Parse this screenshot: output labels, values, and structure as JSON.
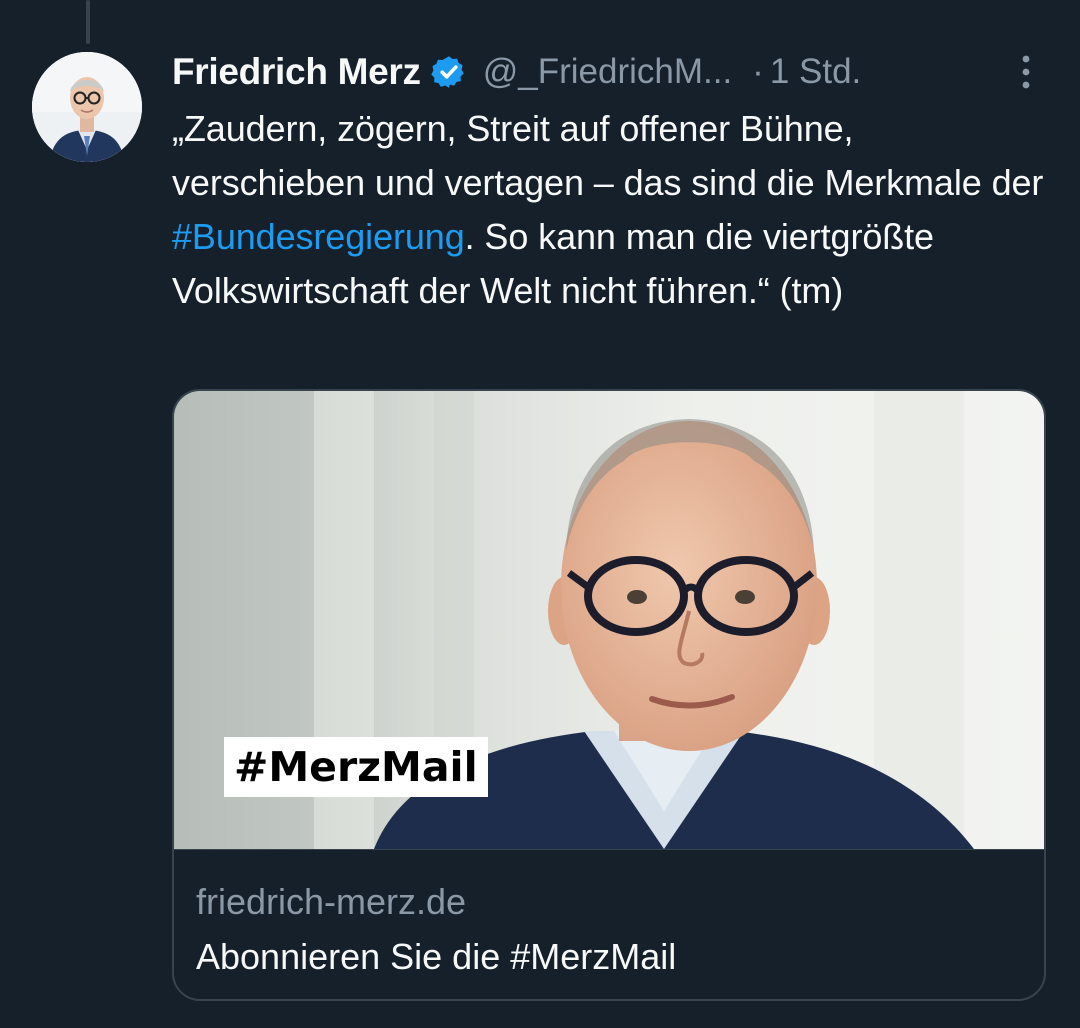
{
  "tweet": {
    "author": {
      "name": "Friedrich Merz",
      "handle": "@_FriedrichM...",
      "verified": true
    },
    "separator": "·",
    "time": "1 Std.",
    "text_parts": {
      "p1": "„Zaudern, zögern, Streit auf offener Bühne, verschieben und vertagen – das sind die Merkmale der ",
      "hashtag": "#Bundesregierung",
      "p2": ". So kann man die viertgrößte Volkswirtschaft der Welt nicht führen.“ (tm)"
    }
  },
  "card": {
    "image_label": "#MerzMail",
    "domain": "friedrich-merz.de",
    "title": "Abonnieren Sie die #MerzMail"
  },
  "colors": {
    "background": "#15202b",
    "text": "#f7f9f9",
    "muted": "#8b98a5",
    "accent": "#1d9bf0",
    "border": "#38444d"
  },
  "icons": {
    "verified": "verified-badge-icon",
    "more": "more-options-icon"
  }
}
